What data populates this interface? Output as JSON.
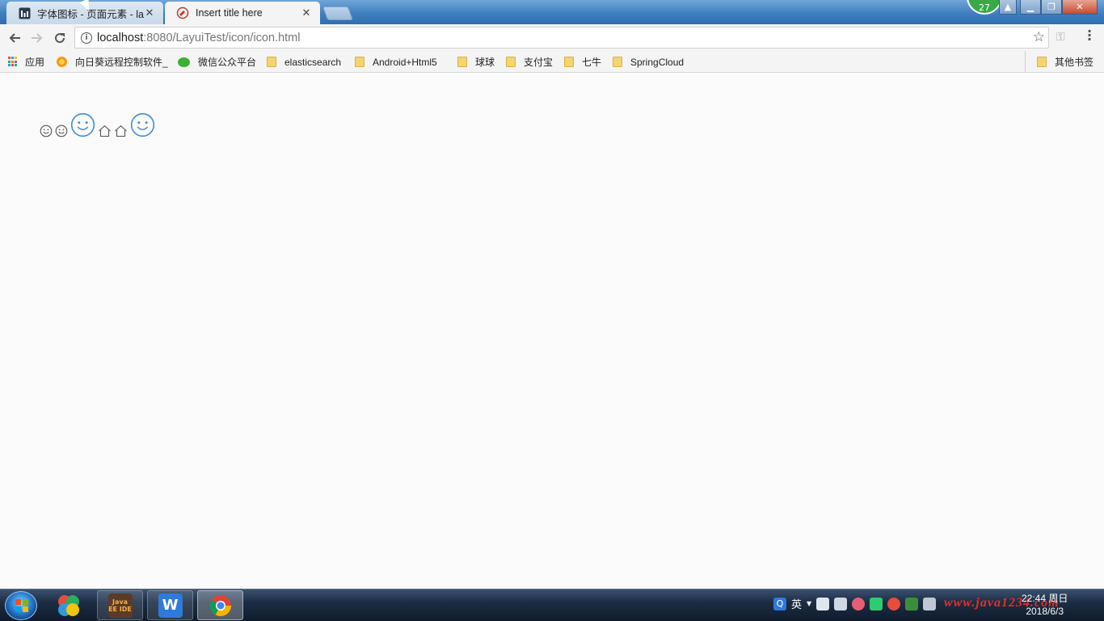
{
  "browser": {
    "tabs": [
      {
        "title": "字体图标 - 页面元素 - la",
        "active": false
      },
      {
        "title": "Insert title here",
        "active": true
      }
    ],
    "profile_badge": "27",
    "url_host": "localhost",
    "url_rest": ":8080/LayuiTest/icon/icon.html",
    "info_icon_glyph": "i",
    "bookmarks": [
      {
        "label": "应用",
        "icon": "apps-icon"
      },
      {
        "label": "向日葵远程控制软件_",
        "icon": "sunflower-icon"
      },
      {
        "label": "微信公众平台",
        "icon": "wechat-icon"
      },
      {
        "label": "elasticsearch",
        "icon": "folder-icon"
      },
      {
        "label": "Android+Html5",
        "icon": "folder-icon"
      },
      {
        "label": "球球",
        "icon": "folder-icon"
      },
      {
        "label": "支付宝",
        "icon": "folder-icon"
      },
      {
        "label": "七牛",
        "icon": "folder-icon"
      },
      {
        "label": "SpringCloud",
        "icon": "folder-icon"
      }
    ],
    "other_bookmarks": "其他书签"
  },
  "page": {
    "icons": [
      {
        "name": "smile-icon",
        "size": "small",
        "color": "#555555"
      },
      {
        "name": "smile-icon",
        "size": "small",
        "color": "#555555"
      },
      {
        "name": "smile-icon",
        "size": "large",
        "color": "#3a8fd9"
      },
      {
        "name": "home-icon",
        "size": "small",
        "color": "#555555"
      },
      {
        "name": "home-icon",
        "size": "small",
        "color": "#555555"
      },
      {
        "name": "smile-icon",
        "size": "large",
        "color": "#3a8fd9"
      }
    ]
  },
  "taskbar": {
    "apps": [
      {
        "name": "photos-app",
        "label": ""
      },
      {
        "name": "java-ee-ide-app",
        "label": "Java EE IDE"
      },
      {
        "name": "wps-app",
        "label": "W"
      },
      {
        "name": "chrome-app",
        "label": ""
      }
    ],
    "ime_label": "英",
    "time": "22:44 周日",
    "date": "2018/6/3",
    "watermark": "www.java1234.com"
  },
  "colors": {
    "accent_blue": "#3a8fd9",
    "icon_gray": "#555555",
    "close_red": "#c74b2e"
  }
}
